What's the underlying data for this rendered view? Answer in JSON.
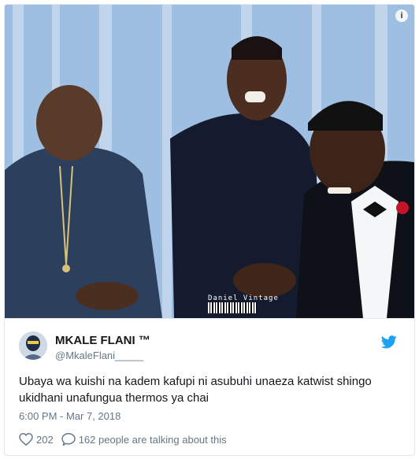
{
  "tweet": {
    "display_name": "MKALE FLANI ™",
    "handle": "@MkaleFlani_____",
    "text": "Ubaya wa kuishi na kadem kafupi ni asubuhi unaeza katwist shingo ukidhani unafungua thermos ya chai",
    "timestamp": "6:00 PM - Mar 7, 2018",
    "likes": "202",
    "replies": "162 people are talking about this"
  },
  "photo": {
    "watermark": "Daniel Vintage",
    "info_glyph": "i"
  },
  "icons": {
    "brand": "twitter-bird-icon",
    "like": "heart-icon",
    "reply": "speech-bubble-icon",
    "info": "info-icon"
  },
  "colors": {
    "twitter_blue": "#1da1f2",
    "secondary_text": "#657786",
    "primary_text": "#14171a",
    "border": "#e1e8ed"
  }
}
